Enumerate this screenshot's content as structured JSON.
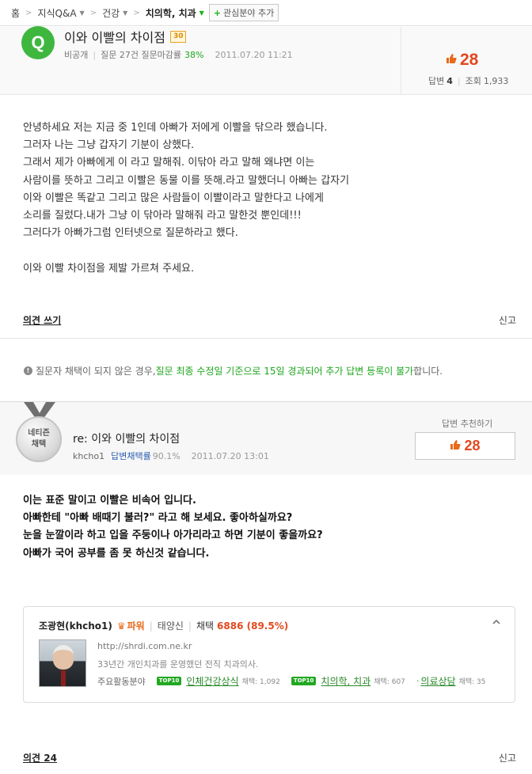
{
  "breadcrumb": {
    "home": "홈",
    "qa": "지식Q&A",
    "health": "건강",
    "current": "치의학, 치과",
    "add_interest": "관심분야 추가"
  },
  "question": {
    "badge": "Q",
    "title": "이와 이빨의 차이점",
    "points": "30",
    "author": "비공개",
    "meta_prefix": "질문 27건  질문마감률",
    "close_rate": "38%",
    "date": "2011.07.20 11:21",
    "likes": "28",
    "answers_label": "답변",
    "answers": "4",
    "views_label": "조회",
    "views": "1,933",
    "body": [
      "안녕하세요 저는 지금 중 1인데 아빠가 저에게 이빨을 닦으라 했습니다.",
      "그러자 나는 그냥 갑자기 기분이 상했다.",
      "그래서 제가 아빠에게 이 라고 말해줘. 이닦아 라고 말해 왜냐면 이는",
      "사람이를 뜻하고 그리고 이빨은 동물 이를 뜻해.라고 말했더니 아빠는 갑자기",
      "이와 이빨은 똑같고 그리고 많은 사람들이 이빨이라고 말한다고 나에게",
      "소리를 질렀다.내가 그냥 이 닦아라 말해줘 라고 말한것 뿐인데!!!",
      "그러다가 아빠가그럼 인터넷으로 질문하라고 했다.",
      "",
      "이와 이빨 차이점을 제발 가르쳐 주세요."
    ],
    "opinion_label": "의견 쓰기",
    "report_label": "신고"
  },
  "notice": {
    "prefix": "질문자 채택이 되지 않은 경우, ",
    "highlight": "질문 최종 수정일 기준으로 15일 경과되어 추가 답변 등록이 불가",
    "suffix": "합니다."
  },
  "answer": {
    "medal_line1": "네티즌",
    "medal_line2": "채택",
    "title": "re: 이와 이빨의 차이점",
    "author": "khcho1",
    "adopt_label": "답변채택률",
    "adopt_rate": "90.1%",
    "date": "2011.07.20 13:01",
    "recommend_label": "답변 추천하기",
    "recommend_count": "28",
    "body": [
      "이는 표준 말이고 이빨은 비속어 입니다.",
      "아빠한테 \"아빠 배때기 불러?\" 라고 해 보세요. 좋아하실까요?",
      "눈을 눈깔이라 하고 입을 주둥이나 아가리라고 하면 기분이 좋을까요?",
      "아빠가 국어 공부를 좀 못 하신것 같습니다."
    ],
    "opinion_label": "의견 24",
    "report_label": "신고"
  },
  "profile": {
    "name": "조광현(khcho1)",
    "rank": "파워",
    "level": "태양신",
    "adopt_label": "채택",
    "adopt_value": "6886 (89.5%)",
    "url": "http://shrdi.com.ne.kr",
    "desc": "33년간 개인치과를 운영했던 전직 치과의사.",
    "fields_label": "주요활동분야",
    "fields": [
      {
        "badge": "TOP10",
        "name": "인체건강상식",
        "count": "채택: 1,092"
      },
      {
        "badge": "TOP10",
        "name": "치의학, 치과",
        "count": "채택: 607"
      },
      {
        "badge": "",
        "name": "의료상담",
        "count": "채택: 35"
      }
    ]
  },
  "colors": {
    "green": "#1ea61e",
    "orange_red": "#e2491e",
    "link_blue": "#2a5db0"
  }
}
